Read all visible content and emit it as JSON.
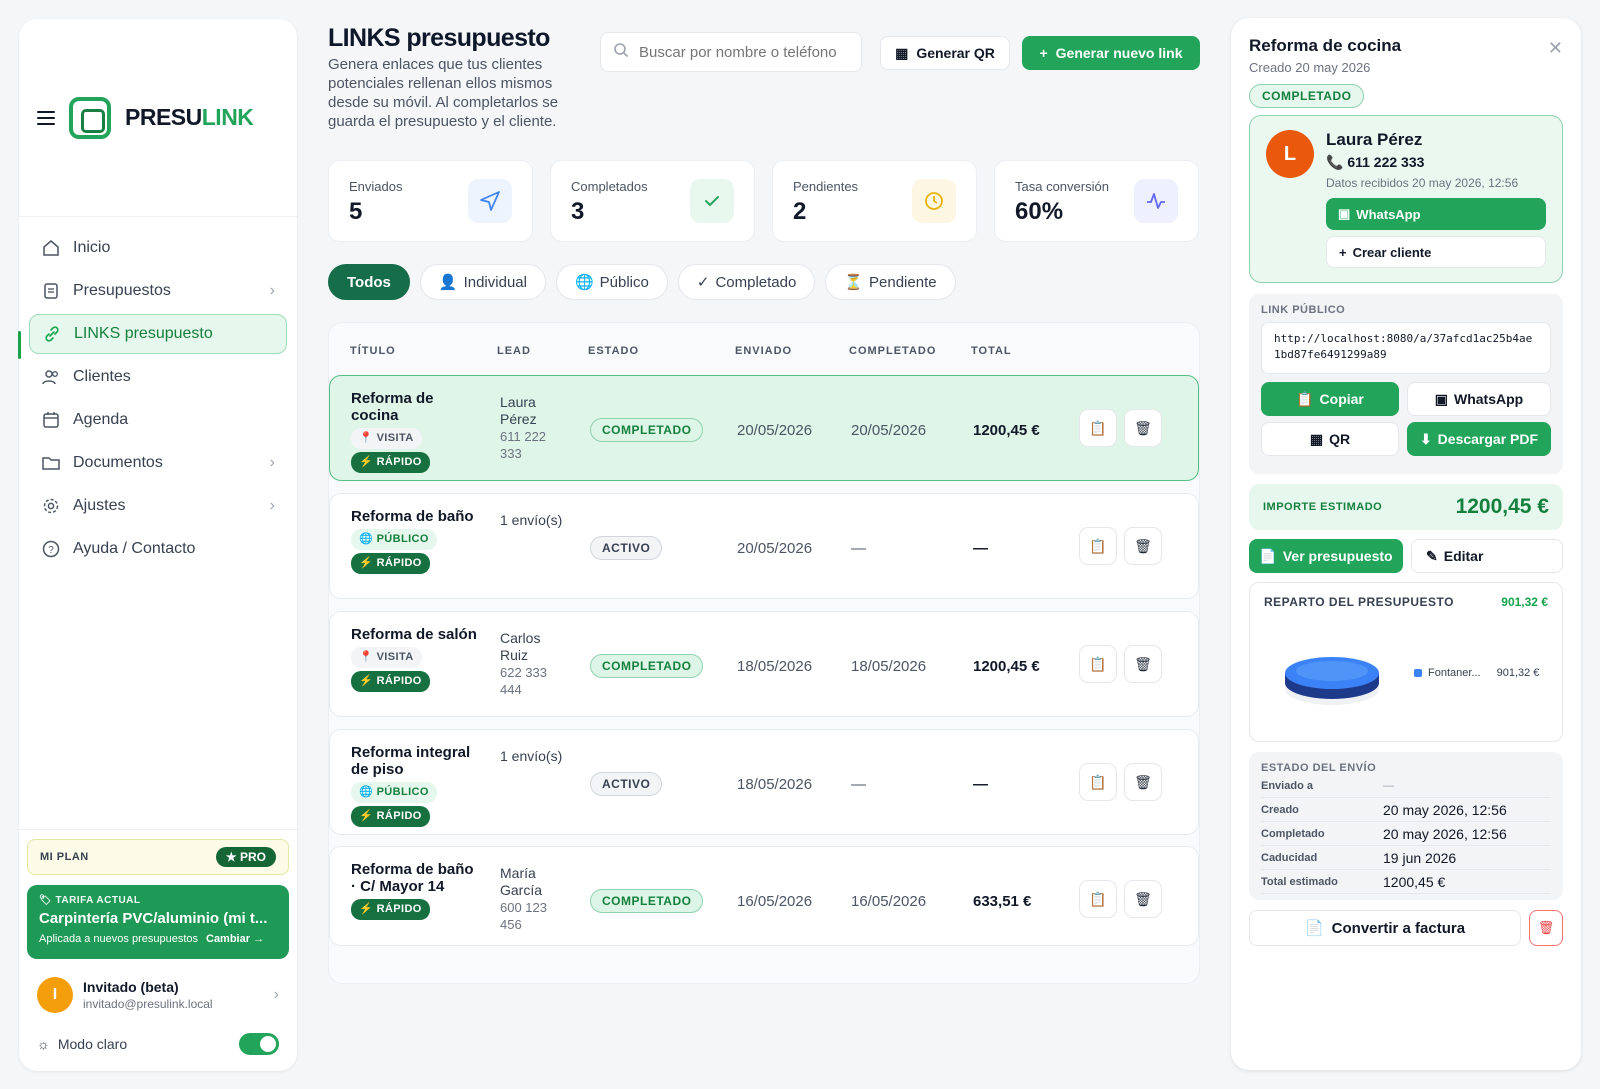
{
  "brand": {
    "name_a": "PRESU",
    "name_b": "LINK",
    "accent": "#22a55a"
  },
  "sidebar": {
    "items": [
      {
        "label": "Inicio",
        "icon": "home-icon",
        "chevron": false
      },
      {
        "label": "Presupuestos",
        "icon": "document-icon",
        "chevron": true
      },
      {
        "label": "LINKS presupuesto",
        "icon": "link-icon",
        "chevron": false,
        "active": true
      },
      {
        "label": "Clientes",
        "icon": "users-icon",
        "chevron": false
      },
      {
        "label": "Agenda",
        "icon": "calendar-icon",
        "chevron": false
      },
      {
        "label": "Documentos",
        "icon": "folder-icon",
        "chevron": true
      },
      {
        "label": "Ajustes",
        "icon": "gear-icon",
        "chevron": true
      },
      {
        "label": "Ayuda / Contacto",
        "icon": "help-icon",
        "chevron": false
      }
    ],
    "plan": {
      "label": "MI PLAN",
      "badge": "★ PRO"
    },
    "tarifa": {
      "label": "TARIFA ACTUAL",
      "name": "Carpintería PVC/aluminio (mi t...",
      "note": "Aplicada a nuevos presupuestos",
      "action": "Cambiar →"
    },
    "user": {
      "initial": "I",
      "name": "Invitado (beta)",
      "email": "invitado@presulink.local"
    },
    "mode_label": "Modo claro"
  },
  "header": {
    "title": "LINKS presupuesto",
    "description": "Genera enlaces que tus clientes potenciales rellenan ellos mismos desde su móvil. Al completarlos se guarda el presupuesto y el cliente.",
    "search_placeholder": "Buscar por nombre o teléfono",
    "qr_label": "Generar QR",
    "new_label": "Generar nuevo link"
  },
  "stats": [
    {
      "label": "Enviados",
      "value": "5",
      "icon": "send-icon",
      "bg": "#eef4fd",
      "fg": "#3b82f6"
    },
    {
      "label": "Completados",
      "value": "3",
      "icon": "check-icon",
      "bg": "#e9f8ef",
      "fg": "#22a55a"
    },
    {
      "label": "Pendientes",
      "value": "2",
      "icon": "clock-icon",
      "bg": "#fdf6e3",
      "fg": "#eab308"
    },
    {
      "label": "Tasa conversión",
      "value": "60%",
      "icon": "activity-icon",
      "bg": "#eef0fd",
      "fg": "#6366f1"
    }
  ],
  "filters": [
    {
      "label": "Todos",
      "icon": ""
    },
    {
      "label": "Individual",
      "icon": "👤"
    },
    {
      "label": "Público",
      "icon": "🌐"
    },
    {
      "label": "Completado",
      "icon": "✓"
    },
    {
      "label": "Pendiente",
      "icon": "⏳"
    }
  ],
  "table": {
    "columns": [
      "TÍTULO",
      "LEAD",
      "ESTADO",
      "ENVIADO",
      "COMPLETADO",
      "TOTAL"
    ],
    "rows": [
      {
        "title": "Reforma de cocina",
        "tag1": "VISITA",
        "tag1_type": "visita",
        "tag1_icon": "📍",
        "tag2": "RÁPIDO",
        "lead_name": "Laura Pérez",
        "lead_phone": "611 222 333",
        "status": "COMPLETADO",
        "status_type": "done",
        "sent": "20/05/2026",
        "completed": "20/05/2026",
        "total": "1200,45 €",
        "selected": true
      },
      {
        "title": "Reforma de baño",
        "tag1": "PÚBLICO",
        "tag1_type": "publico",
        "tag1_icon": "🌐",
        "tag2": "RÁPIDO",
        "lead_name": "1 envío(s)",
        "lead_phone": "",
        "status": "ACTIVO",
        "status_type": "act",
        "sent": "20/05/2026",
        "completed": "—",
        "total": "—",
        "selected": false
      },
      {
        "title": "Reforma de salón",
        "tag1": "VISITA",
        "tag1_type": "visita",
        "tag1_icon": "📍",
        "tag2": "RÁPIDO",
        "lead_name": "Carlos Ruiz",
        "lead_phone": "622 333 444",
        "status": "COMPLETADO",
        "status_type": "done",
        "sent": "18/05/2026",
        "completed": "18/05/2026",
        "total": "1200,45 €",
        "selected": false
      },
      {
        "title": "Reforma integral de piso",
        "tag1": "PÚBLICO",
        "tag1_type": "publico",
        "tag1_icon": "🌐",
        "tag2": "RÁPIDO",
        "lead_name": "1 envío(s)",
        "lead_phone": "",
        "status": "ACTIVO",
        "status_type": "act",
        "sent": "18/05/2026",
        "completed": "—",
        "total": "—",
        "selected": false
      },
      {
        "title": "Reforma de baño · C/ Mayor 14",
        "tag1": "",
        "tag1_type": "",
        "tag1_icon": "",
        "tag2": "RÁPIDO",
        "lead_name": "María García",
        "lead_phone": "600 123 456",
        "status": "COMPLETADO",
        "status_type": "done",
        "sent": "16/05/2026",
        "completed": "16/05/2026",
        "total": "633,51 €",
        "selected": false
      }
    ]
  },
  "detail": {
    "title": "Reforma de cocina",
    "created": "Creado 20 may 2026",
    "status": "COMPLETADO",
    "client": {
      "initial": "L",
      "name": "Laura Pérez",
      "phone": "611 222 333",
      "received": "Datos recibidos 20 may 2026, 12:56",
      "whatsapp": "WhatsApp",
      "create": "Crear cliente"
    },
    "link": {
      "label": "LINK PÚBLICO",
      "url": "http://localhost:8080/a/37afcd1ac25b4ae1bd87fe6491299a89",
      "copy": "Copiar",
      "whatsapp": "WhatsApp",
      "qr": "QR",
      "pdf": "Descargar PDF"
    },
    "importe": {
      "label": "IMPORTE ESTIMADO",
      "value": "1200,45 €"
    },
    "ver": "Ver presupuesto",
    "editar": "Editar",
    "reparto": {
      "label": "REPARTO DEL PRESUPUESTO",
      "value": "901,32 €",
      "legend_name": "Fontaner...",
      "legend_value": "901,32 €"
    },
    "envio": {
      "label": "ESTADO DEL ENVÍO",
      "rows": [
        {
          "k": "Enviado a",
          "v": "—"
        },
        {
          "k": "Creado",
          "v": "20 may 2026, 12:56"
        },
        {
          "k": "Completado",
          "v": "20 may 2026, 12:56"
        },
        {
          "k": "Caducidad",
          "v": "19 jun 2026"
        },
        {
          "k": "Total estimado",
          "v": "1200,45 €"
        }
      ]
    },
    "convertir": "Convertir a factura"
  }
}
